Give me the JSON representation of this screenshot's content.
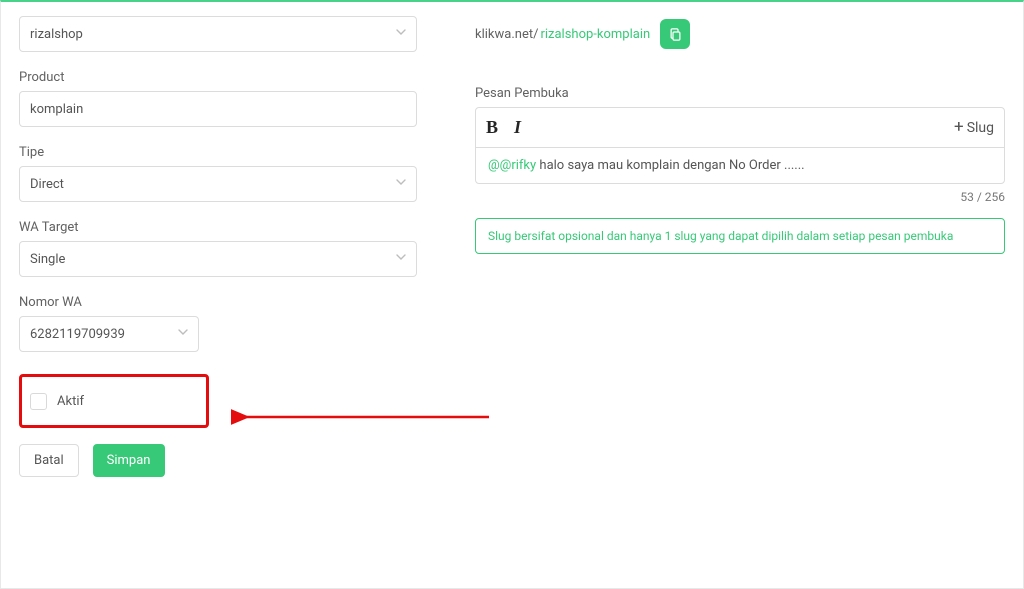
{
  "shop_select": {
    "value": "rizalshop"
  },
  "url": {
    "domain": "klikwa.net/",
    "slug": "rizalshop-komplain"
  },
  "fields": {
    "product_label": "Product",
    "product_value": "komplain",
    "tipe_label": "Tipe",
    "tipe_value": "Direct",
    "wa_target_label": "WA Target",
    "wa_target_value": "Single",
    "nomor_wa_label": "Nomor WA",
    "nomor_wa_value": "6282119709939"
  },
  "aktif": {
    "label": "Aktif",
    "checked": false
  },
  "buttons": {
    "cancel": "Batal",
    "save": "Simpan",
    "slug": "Slug"
  },
  "editor": {
    "label": "Pesan Pembuka",
    "mention": "@@rifky",
    "body_rest": " halo saya mau komplain dengan No Order ......",
    "counter": "53 / 256",
    "hint": "Slug bersifat opsional dan hanya 1 slug yang dapat dipilih dalam setiap pesan pembuka"
  }
}
